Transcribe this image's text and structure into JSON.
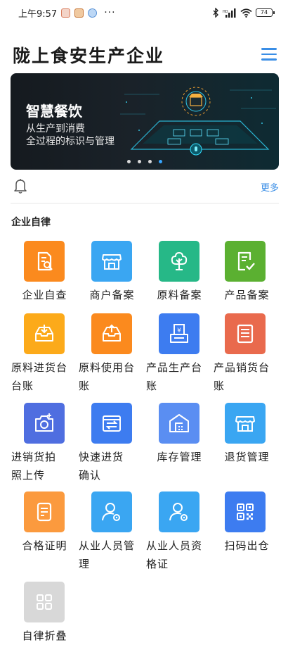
{
  "status_bar": {
    "time": "上午9:57",
    "battery": "74"
  },
  "header": {
    "title": "陇上食安生产企业"
  },
  "banner": {
    "title": "智慧餐饮",
    "subtitle_line1": "从生产到消费",
    "subtitle_line2": "全过程的标识与管理",
    "active_dot": 4,
    "dot_count": 4
  },
  "notice": {
    "more": "更多"
  },
  "section": {
    "title": "企业自律"
  },
  "colors": {
    "orange": "#fb8a1e",
    "sky": "#3aa6f2",
    "green": "#26b887",
    "leaf": "#5bb031",
    "amber": "#fcaa1a",
    "blue": "#3d7cf0",
    "coral": "#e96a4d",
    "indigo": "#4f6ee0",
    "tile_orange_light": "#fb9a3e",
    "gray": "#d8d8d8",
    "accent": "#3a8ee6"
  },
  "grid": {
    "items": [
      {
        "line1": "企业自查",
        "line2": "",
        "icon": "search-document-icon"
      },
      {
        "line1": "商户备案",
        "line2": "",
        "icon": "storefront-icon"
      },
      {
        "line1": "原料备案",
        "line2": "",
        "icon": "tree-icon"
      },
      {
        "line1": "产品备案",
        "line2": "",
        "icon": "checked-document-icon"
      },
      {
        "line1": "原料进货台",
        "line2": "台账",
        "icon": "inbox-in-icon"
      },
      {
        "line1": "原料使用台",
        "line2": "账",
        "icon": "inbox-out-icon"
      },
      {
        "line1": "产品生产台",
        "line2": "账",
        "icon": "yuan-printer-icon"
      },
      {
        "line1": "产品销货台",
        "line2": "账",
        "icon": "list-document-icon"
      },
      {
        "line1": "进销货拍",
        "line2": "照上传",
        "icon": "camera-icon"
      },
      {
        "line1": "快速进货",
        "line2": "确认",
        "icon": "transfer-box-icon"
      },
      {
        "line1": "库存管理",
        "line2": "",
        "icon": "warehouse-icon"
      },
      {
        "line1": "退货管理",
        "line2": "",
        "icon": "store-return-icon"
      },
      {
        "line1": "合格证明",
        "line2": "",
        "icon": "certificate-icon"
      },
      {
        "line1": "从业人员管",
        "line2": "理",
        "icon": "user-settings-icon"
      },
      {
        "line1": "从业人员资",
        "line2": "格证",
        "icon": "user-certificate-icon"
      },
      {
        "line1": "扫码出仓",
        "line2": "",
        "icon": "qr-code-icon"
      },
      {
        "line1": "自律折叠",
        "line2": "",
        "icon": "grid-collapse-icon"
      }
    ]
  }
}
